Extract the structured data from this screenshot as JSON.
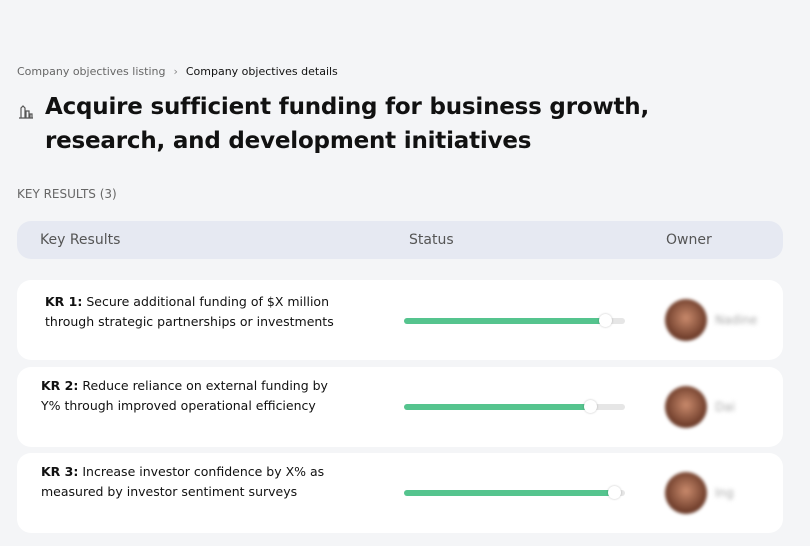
{
  "breadcrumb": {
    "parent": "Company objectives listing",
    "separator": "›",
    "current": "Company objectives details"
  },
  "objective": {
    "icon": "building-chart-icon",
    "title": "Acquire sufficient funding for business growth, research, and development initiatives"
  },
  "key_results_label": "KEY RESULTS (3)",
  "table": {
    "headers": [
      "Key Results",
      "Status",
      "Owner"
    ]
  },
  "accent_color": "#55c48e",
  "rows": [
    {
      "id": "KR 1:",
      "text": "Secure additional funding of $X million through strategic partnerships or investments",
      "progress": 91,
      "owner": "Nadine"
    },
    {
      "id": "KR 2:",
      "text": "Reduce reliance on external funding by Y% through improved operational efficiency",
      "progress": 84,
      "owner": "Dai"
    },
    {
      "id": "KR 3:",
      "text": "Increase investor confidence by X% as measured by investor sentiment surveys",
      "progress": 95,
      "owner": "Ing"
    }
  ]
}
